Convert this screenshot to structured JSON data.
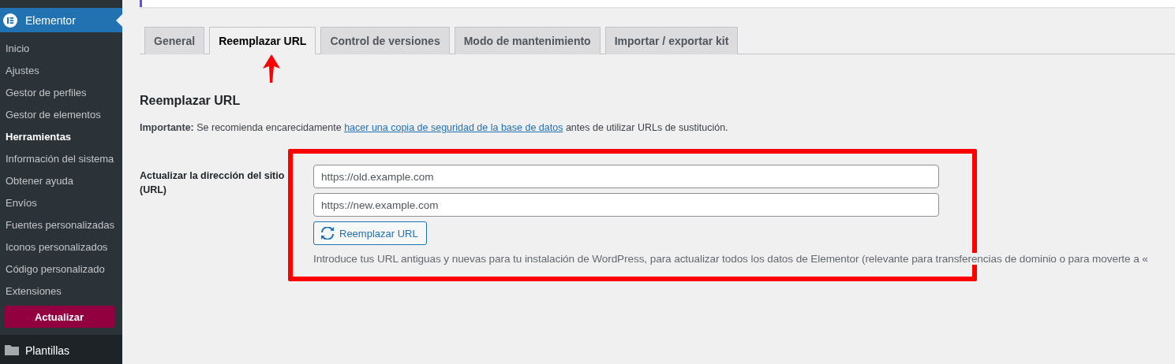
{
  "sidebar": {
    "header": {
      "label": "Elementor"
    },
    "items": [
      {
        "label": "Inicio",
        "selected": false
      },
      {
        "label": "Ajustes",
        "selected": false
      },
      {
        "label": "Gestor de perfiles",
        "selected": false
      },
      {
        "label": "Gestor de elementos",
        "selected": false
      },
      {
        "label": "Herramientas",
        "selected": true
      },
      {
        "label": "Información del sistema",
        "selected": false
      },
      {
        "label": "Obtener ayuda",
        "selected": false
      },
      {
        "label": "Envíos",
        "selected": false
      },
      {
        "label": "Fuentes personalizadas",
        "selected": false
      },
      {
        "label": "Iconos personalizados",
        "selected": false
      },
      {
        "label": "Código personalizado",
        "selected": false
      },
      {
        "label": "Extensiones",
        "selected": false
      }
    ],
    "upgrade_button": "Actualizar",
    "next_menu": {
      "label": "Plantillas"
    }
  },
  "tabs": [
    {
      "label": "General",
      "selected": false
    },
    {
      "label": "Reemplazar URL",
      "selected": true
    },
    {
      "label": "Control de versiones",
      "selected": false
    },
    {
      "label": "Modo de mantenimiento",
      "selected": false
    },
    {
      "label": "Importar / exportar kit",
      "selected": false
    }
  ],
  "section": {
    "title": "Reemplazar URL",
    "notice": "**Importante:** Se recomienda encarecidamente ",
    "notice_link": "hacer una copia de seguridad de la base de datos",
    "notice_end": " antes de utilizar URLs de sustitución.",
    "field_label": "Actualizar la dirección del sitio (URL)",
    "old_url": {
      "placeholder": "https://old.example.com"
    },
    "new_url": {
      "placeholder": "https://new.example.com"
    },
    "button": "Reemplazar URL",
    "description": "Introduce tus URL antiguas y nuevas para tu instalación de WordPress, para actualizar todos los datos de Elementor (relevante para transferencias de dominio o para moverte a «"
  }
}
